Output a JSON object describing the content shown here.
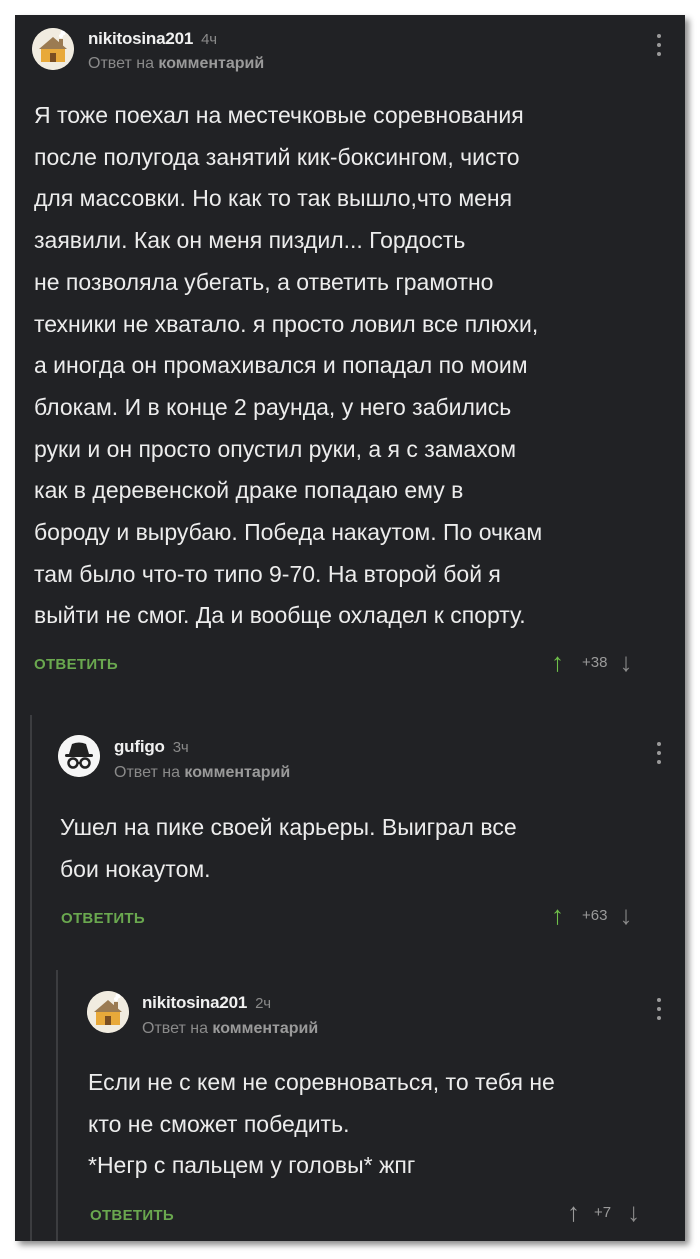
{
  "comments": [
    {
      "username": "nikitosina201",
      "time": "4ч",
      "reply_prefix": "Ответ на",
      "reply_target": "комментарий",
      "text": "Я тоже поехал на местечковые соревнования\nпосле полугода занятий кик-боксингом, чисто\nдля массовки. Но как то так вышло,что меня\nзаявили. Как он меня пиздил... Гордость\nне позволяла убегать, а ответить грамотно\nтехники не хватало.  я просто ловил все плюхи,\nа иногда он промахивался и попадал по моим\nблокам. И в конце 2 раунда, у него забились\nруки и он просто опустил руки, а я с замахом\nкак  в деревенской драке попадаю ему в\nбороду и вырубаю. Победа накаутом. По очкам\nтам было что-то типо 9-70. На второй бой я\nвыйти не смог. Да и вообще охладел к спорту.",
      "reply_label": "ОТВЕТИТЬ",
      "score": "+38",
      "avatar_icon": "house-avatar-icon"
    },
    {
      "username": "gufigo",
      "time": "3ч",
      "reply_prefix": "Ответ на",
      "reply_target": "комментарий",
      "text": "Ушел на пике своей карьеры. Выиграл все\nбои нокаутом.",
      "reply_label": "ОТВЕТИТЬ",
      "score": "+63",
      "avatar_icon": "incognito-avatar-icon"
    },
    {
      "username": "nikitosina201",
      "time": "2ч",
      "reply_prefix": "Ответ на",
      "reply_target": "комментарий",
      "text": "Если не с кем не соревноваться, то тебя не\nкто не сможет победить.\n*Негр с пальцем у головы* жпг",
      "reply_label": "ОТВЕТИТЬ",
      "score": "+7",
      "avatar_icon": "house-avatar-icon"
    }
  ],
  "icons": {
    "upvote": "arrow-up-icon",
    "downvote": "arrow-down-icon",
    "menu": "more-vertical-icon"
  },
  "colors": {
    "background": "#212225",
    "accent_green": "#6aa84f",
    "text": "#ececec",
    "muted": "#8a8a8a"
  }
}
